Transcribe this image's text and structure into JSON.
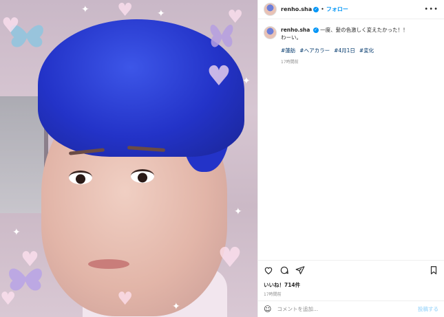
{
  "post": {
    "username": "renho.sha",
    "follow_label": "フォロー",
    "separator": "•",
    "more_label": "•••",
    "caption_line1": "一度、髪の色激しく変えたかった！！",
    "caption_line2": "わーい。",
    "hashtags": [
      "#蓮舫",
      "#ヘアカラー",
      "#4月1日",
      "#変化"
    ],
    "caption_time": "17時間前",
    "likes_prefix": "いいね！",
    "likes_count": "714件",
    "posted_ago": "17時間前",
    "comment_placeholder": "コメントを追加...",
    "post_button": "投稿する"
  },
  "colors": {
    "accent": "#0095f6",
    "hashtag": "#00376b",
    "hair": "#2333c8"
  },
  "icons": [
    "heart-icon",
    "comment-icon",
    "share-icon",
    "bookmark-icon",
    "emoji-icon",
    "verified-badge-icon",
    "more-icon"
  ]
}
